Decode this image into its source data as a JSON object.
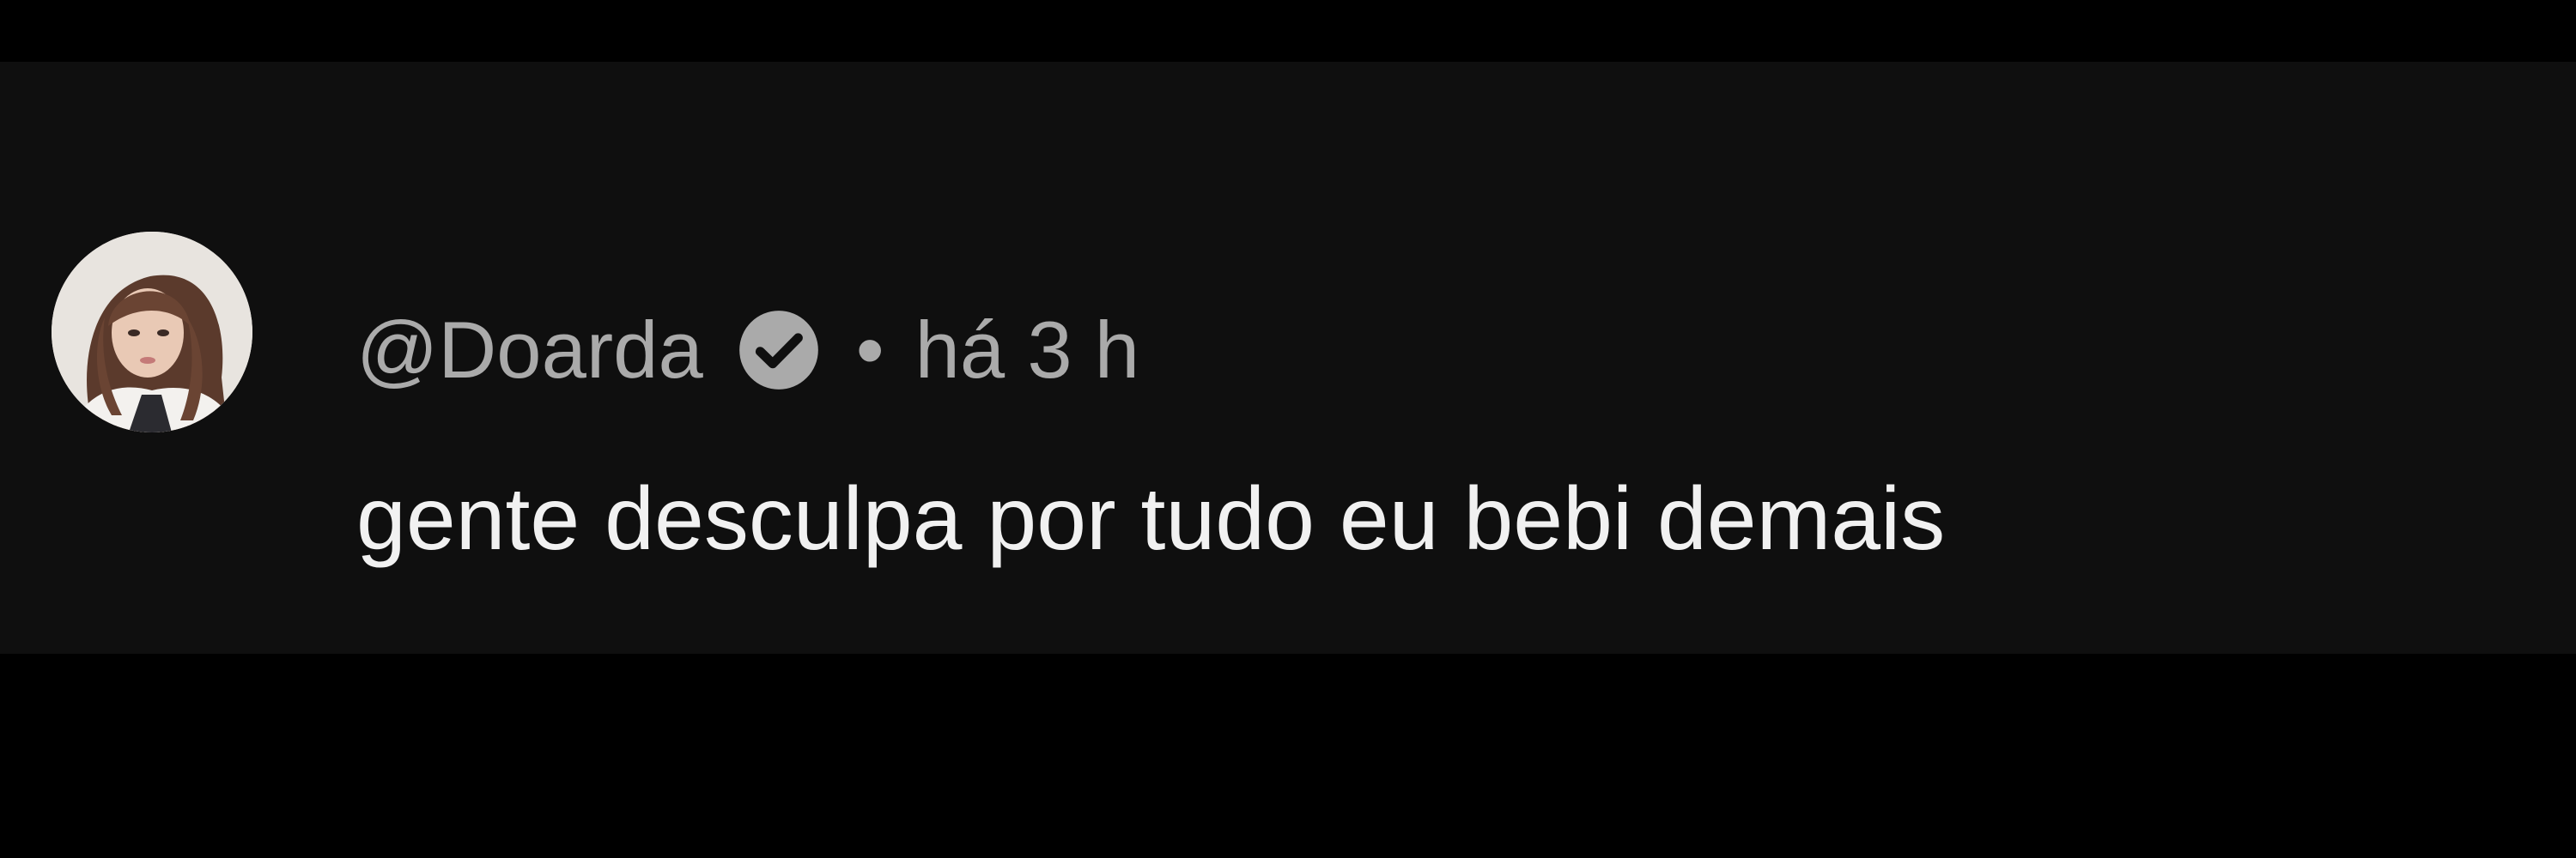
{
  "comment": {
    "author_handle": "@Doarda",
    "verified_icon": "verified-check-icon",
    "separator": "•",
    "timestamp": "há 3 h",
    "text": "gente desculpa por tudo eu bebi demais"
  },
  "colors": {
    "page_background": "#000000",
    "card_background": "#0f0f0f",
    "meta_text": "#aaaaaa",
    "body_text": "#f1f1f1",
    "verified_badge": "#aaaaaa"
  }
}
